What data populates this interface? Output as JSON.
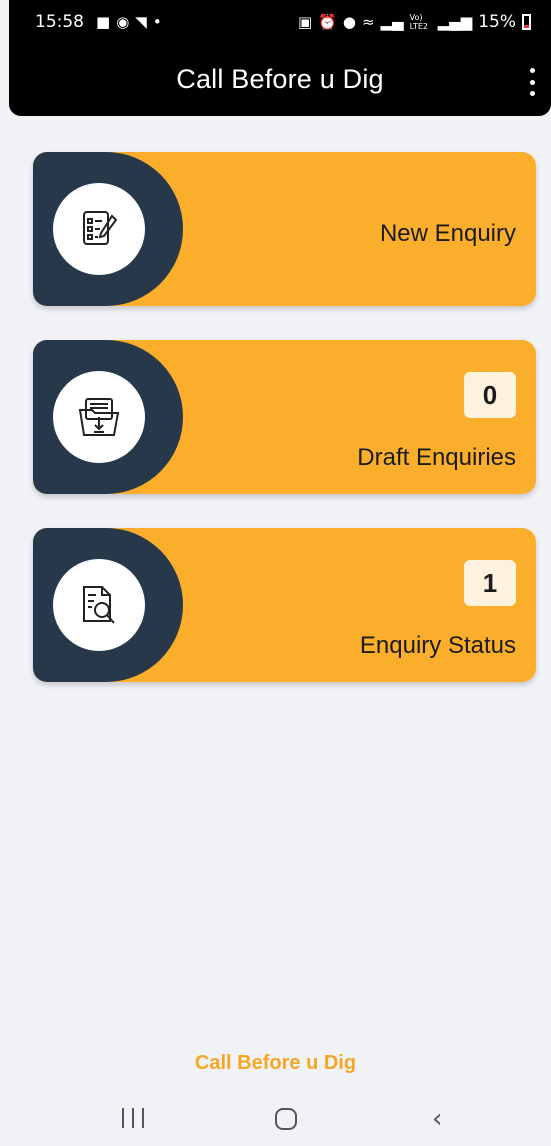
{
  "status_bar": {
    "time": "15:58",
    "battery": "15%",
    "left_icons": [
      "chat-icon",
      "whatsapp-icon",
      "cast-icon",
      "dot-icon"
    ],
    "right_icons": [
      "lock-icon",
      "alarm-icon",
      "location-icon",
      "wifi-icon",
      "signal-icon",
      "volte-icon",
      "signal-icon",
      "battery-icon"
    ],
    "volte_text": "Vo) LTE2"
  },
  "appbar": {
    "title": "Call Before u Dig",
    "menu_icon": "more-vert-icon"
  },
  "cards": [
    {
      "label": "New Enquiry",
      "icon": "checklist-edit-icon",
      "count": null
    },
    {
      "label": "Draft Enquiries",
      "icon": "folder-download-icon",
      "count": "0"
    },
    {
      "label": "Enquiry Status",
      "icon": "document-search-icon",
      "count": "1"
    }
  ],
  "footer": {
    "brand": "Call Before u Dig"
  },
  "colors": {
    "accent": "#faae2c",
    "dark": "#26384a",
    "appbar": "#000000",
    "background": "#f0f2f6"
  }
}
